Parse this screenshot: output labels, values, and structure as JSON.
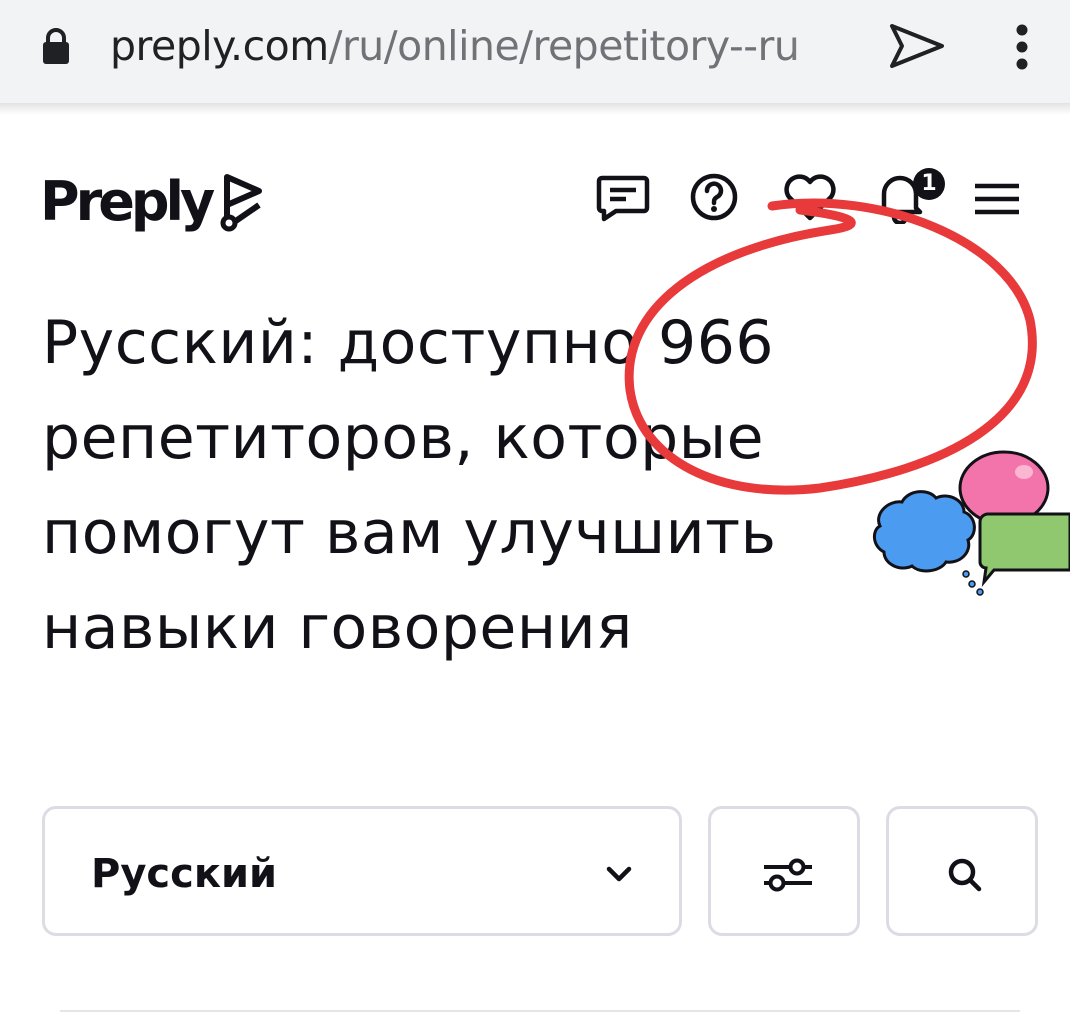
{
  "browser": {
    "url_domain": "preply.com",
    "url_path": "/ru/online/repetitory--ru",
    "lock_icon": "lock-icon",
    "send_icon": "send-icon",
    "menu_icon": "more-vert-icon"
  },
  "header": {
    "logo_text": "Preply",
    "icons": [
      "chat-icon",
      "help-icon",
      "heart-icon",
      "bell-icon",
      "hamburger-menu-icon"
    ],
    "notification_count": "1"
  },
  "main": {
    "heading": "Русский: доступно 966 репетиторов, которые помогут вам улучшить навыки говорения"
  },
  "search": {
    "language_selected": "Русский",
    "filters_icon": "filters-icon",
    "search_icon": "search-icon"
  },
  "colors": {
    "annotation_red": "#e8393b",
    "text": "#121117",
    "border": "#dcdce5",
    "urlbar_bg": "#f1f3f4"
  }
}
